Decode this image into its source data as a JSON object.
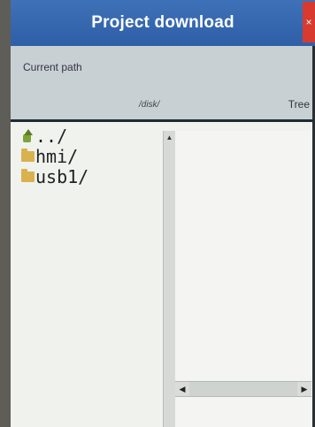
{
  "window": {
    "title": "Project download",
    "close_symbol": "×"
  },
  "path_panel": {
    "caption": "Current path",
    "path": "/disk/",
    "tree_label": "Tree"
  },
  "file_list": [
    {
      "name": "../",
      "icon": "up-folder-icon"
    },
    {
      "name": "hmi/",
      "icon": "folder-icon"
    },
    {
      "name": "usb1/",
      "icon": "folder-icon"
    }
  ],
  "scroll": {
    "up_arrow": "▲",
    "left_arrow": "◀",
    "right_arrow": "▶"
  }
}
